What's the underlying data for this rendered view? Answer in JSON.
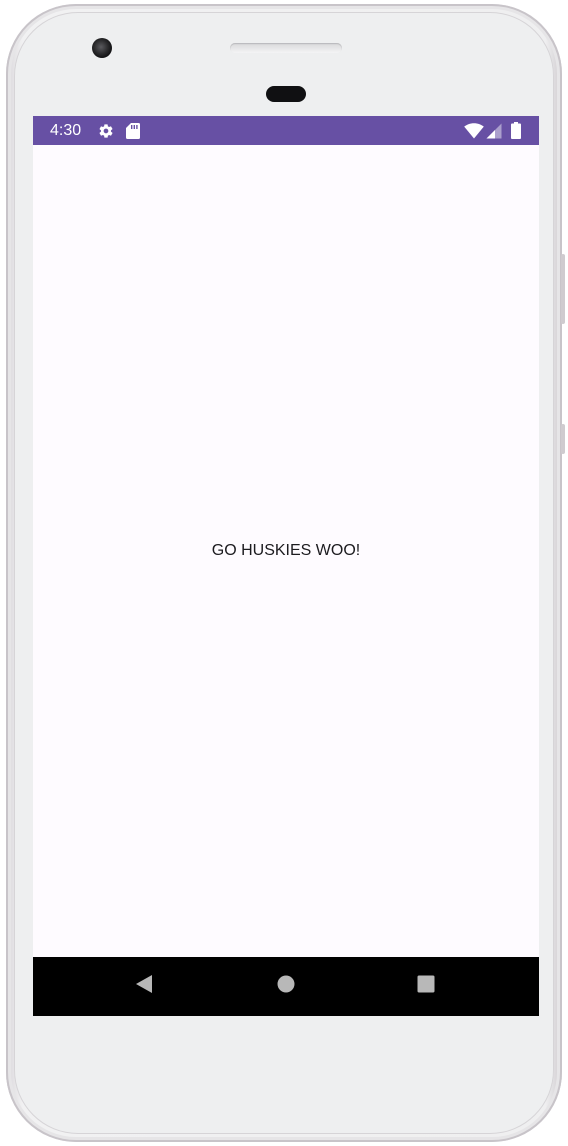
{
  "status_bar": {
    "time": "4:30",
    "background_color": "#6750a4",
    "icons": [
      "settings-icon",
      "sd-card-icon",
      "wifi-icon",
      "signal-icon",
      "battery-icon"
    ]
  },
  "app": {
    "background_color": "#fefbff",
    "message": "GO HUSKIES WOO!"
  },
  "nav_bar": {
    "background_color": "#000000",
    "buttons": [
      "back-icon",
      "home-icon",
      "recents-icon"
    ]
  }
}
